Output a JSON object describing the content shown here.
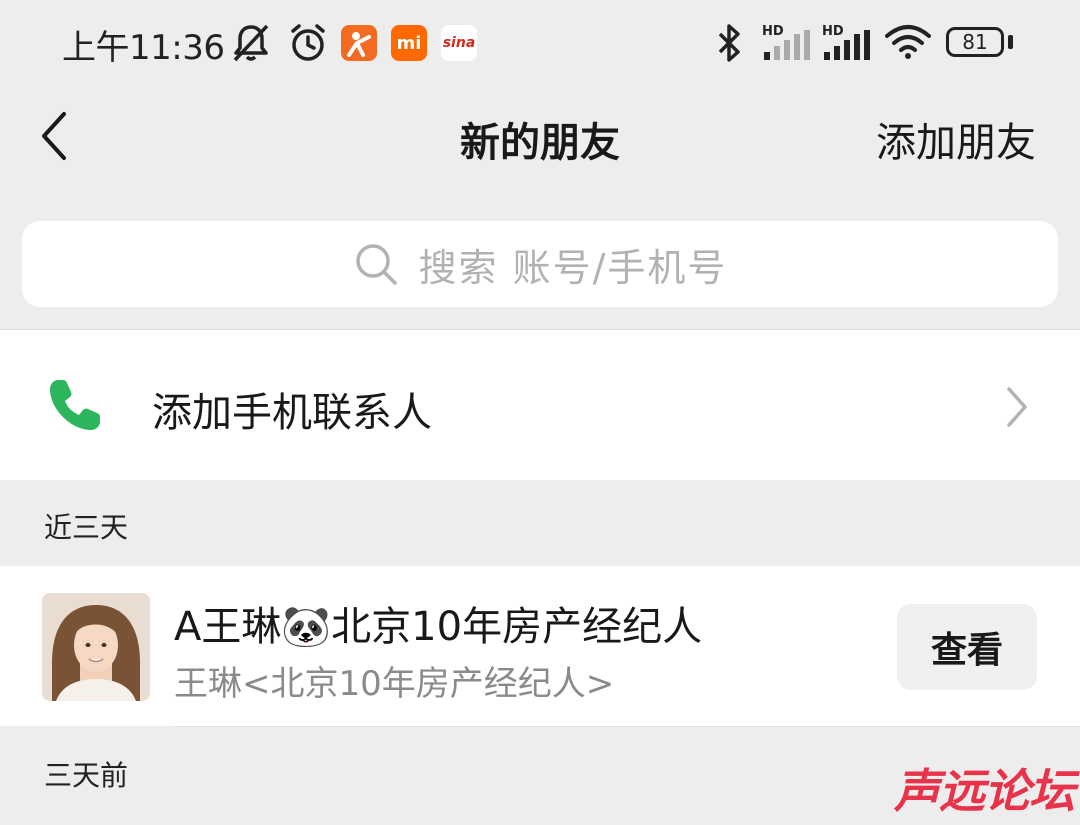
{
  "status_bar": {
    "time": "上午11:36",
    "battery": "81",
    "hd_1": "HD",
    "hd_2": "HD",
    "app_badge_mi": "mi",
    "app_badge_sina": "sina"
  },
  "nav": {
    "title": "新的朋友",
    "action_label": "添加朋友"
  },
  "search": {
    "placeholder": "搜索 账号/手机号"
  },
  "add_contacts": {
    "label": "添加手机联系人"
  },
  "sections": {
    "recent": "近三天",
    "older": "三天前"
  },
  "friend_requests": [
    {
      "name": "A王琳🐼北京10年房产经纪人",
      "subtitle": "王琳<北京10年房产经纪人>",
      "action_label": "查看"
    }
  ],
  "watermark": "声远论坛",
  "colors": {
    "accent_green": "#2db55d",
    "watermark_red": "#e8334a",
    "background": "#ededed"
  }
}
